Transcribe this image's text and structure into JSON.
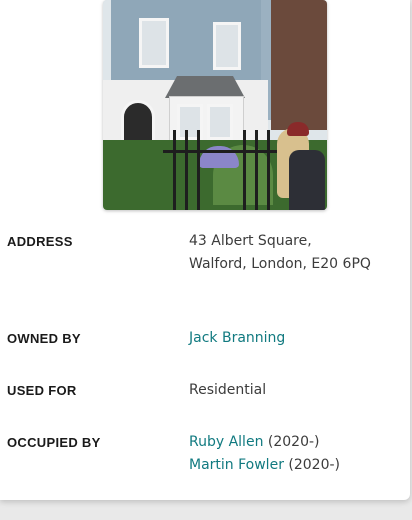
{
  "rows": {
    "address": {
      "label": "ADDRESS",
      "line1": "43 Albert Square,",
      "line2": "Walford, London, E20 6PQ"
    },
    "owned_by": {
      "label": "OWNED BY",
      "value": "Jack Branning"
    },
    "used_for": {
      "label": "USED FOR",
      "value": "Residential"
    },
    "occupied_by": {
      "label": "OCCUPIED BY",
      "occupants": [
        {
          "name": "Ruby Allen",
          "years": "(2020-)"
        },
        {
          "name": "Martin Fowler",
          "years": "(2020-)"
        }
      ]
    }
  },
  "colors": {
    "link": "#117a80",
    "label": "#1a1a1a",
    "text": "#3c3c3c"
  }
}
